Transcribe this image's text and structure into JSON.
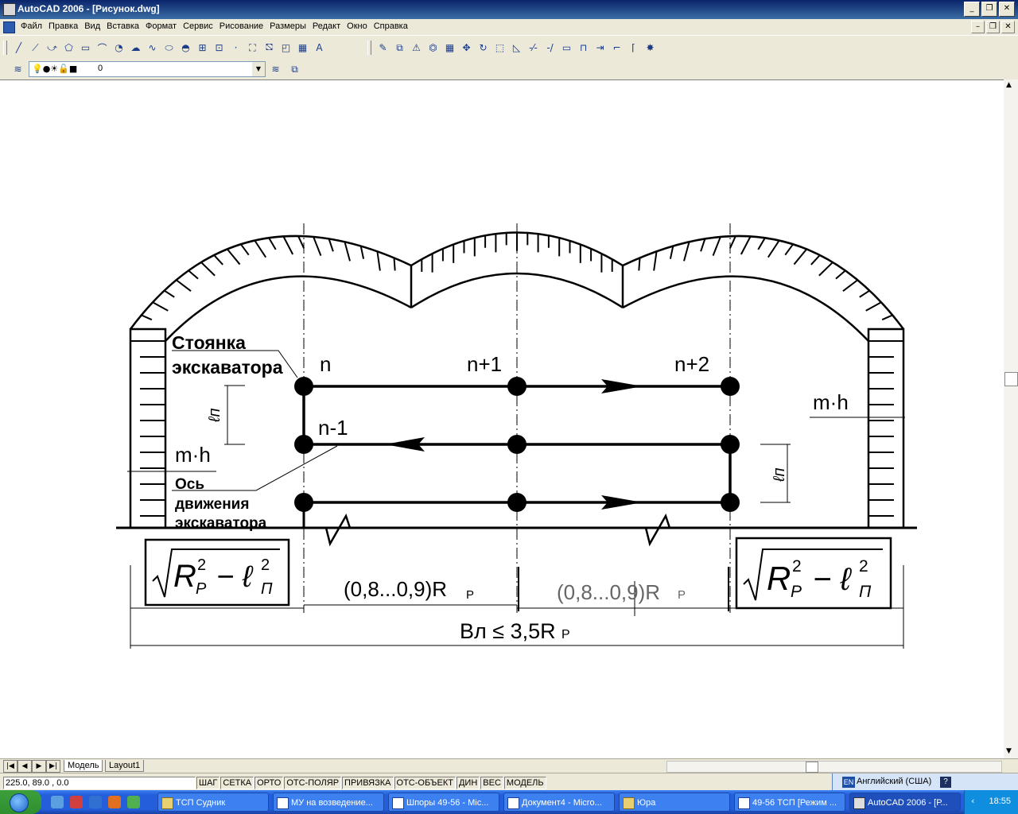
{
  "window": {
    "title": "AutoCAD 2006 - [Рисунок.dwg]",
    "controls": [
      "_",
      "❐",
      "✕"
    ]
  },
  "menu": {
    "items": [
      "Файл",
      "Правка",
      "Вид",
      "Вставка",
      "Формат",
      "Сервис",
      "Рисование",
      "Размеры",
      "Редакт",
      "Окно",
      "Справка"
    ],
    "doc_controls": [
      "–",
      "❐",
      "✕"
    ]
  },
  "toolbar": {
    "draw_tools": [
      "╱",
      "⟋",
      "⤻",
      "⬠",
      "▭",
      "⌒",
      "◔",
      "☁",
      "∿",
      "⬭",
      "◓",
      "⊞",
      "⊡",
      "·",
      "⛶",
      "⛞",
      "◰",
      "▦",
      "A"
    ],
    "modify_tools": [
      "✎",
      "⧉",
      "⚠",
      "⏣",
      "▦",
      "✥",
      "↻",
      "⬚",
      "◺",
      "-⁄-",
      "-/",
      "▭",
      "⊓",
      "⇥",
      "⌐",
      "⌈",
      "✸"
    ],
    "layer_value": "0",
    "layer_icons": "💡●☀🔓■",
    "layer_arrow": "▼"
  },
  "drawing": {
    "labels": {
      "stoyanka_1": "Стоянка",
      "stoyanka_2": "экскаватора",
      "n": "n",
      "n_plus_1": "n+1",
      "n_plus_2": "n+2",
      "n_minus_1": "n-1",
      "mh_left": "m·h",
      "mh_right": "m·h",
      "os_1": "Ось",
      "os_2": "движения",
      "os_3": "экскаватора",
      "ln_left": "ℓп",
      "ln_right": "ℓп",
      "dim_left": "(0,8...0,9)R",
      "dim_left_sub": "Р",
      "dim_right": "(0,8...0,9)R",
      "dim_right_sub": "Р",
      "total": "Вл ≤ 3,5R",
      "total_sub": "Р",
      "formula_R": "R",
      "formula_sup": "2",
      "formula_subP": "P",
      "formula_minus": "− ℓ",
      "formula_subPi": "П"
    }
  },
  "tabs": {
    "nav": [
      "|◀",
      "◀",
      "▶",
      "▶|"
    ],
    "items": [
      "Модель",
      "Layout1"
    ],
    "active": "Модель"
  },
  "status": {
    "coords": "225.0, 89.0 , 0.0",
    "modes": [
      "ШАГ",
      "СЕТКА",
      "ОРТО",
      "ОТС-ПОЛЯР",
      "ПРИВЯЗКА",
      "ОТС-ОБЪЕКТ",
      "ДИН",
      "ВЕС",
      "МОДЕЛЬ"
    ],
    "lang_code": "EN",
    "lang_text": "Английский (США)",
    "lang_help": "?"
  },
  "taskbar": {
    "tasks": [
      "ТСП Судник",
      "МУ на возведение...",
      "Шпоры 49-56 - Mic...",
      "Документ4 - Micro...",
      "Юра",
      "49-56 ТСП [Режим ...",
      "AutoCAD 2006 - [Р..."
    ],
    "active_task": "AutoCAD 2006 - [Р...",
    "clock": "18:55",
    "tray_arrow": "‹"
  },
  "colors": {
    "title_bar": "#0a246a",
    "taskbar": "#245edb",
    "canvas": "#ffffff"
  }
}
